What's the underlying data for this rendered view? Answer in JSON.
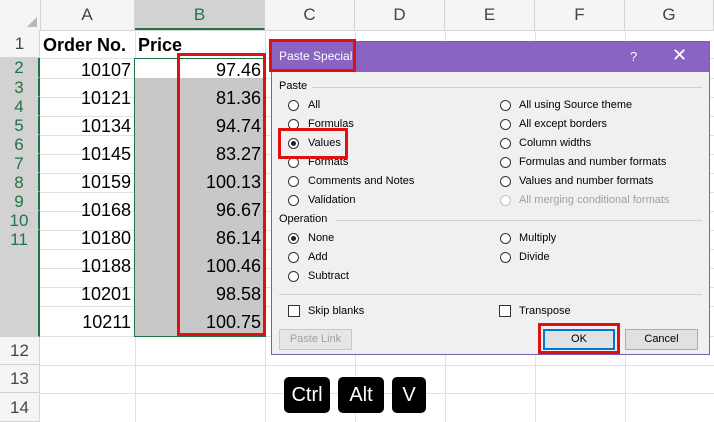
{
  "columns": [
    "A",
    "B",
    "C",
    "D",
    "E",
    "F",
    "G"
  ],
  "rows": [
    "1",
    "2",
    "3",
    "4",
    "5",
    "6",
    "7",
    "8",
    "9",
    "10",
    "11",
    "12",
    "13",
    "14"
  ],
  "headers": {
    "order": "Order No.",
    "price": "Price"
  },
  "order_numbers": [
    "10107",
    "10121",
    "10134",
    "10145",
    "10159",
    "10168",
    "10180",
    "10188",
    "10201",
    "10211"
  ],
  "prices": [
    "97.46",
    "81.36",
    "94.74",
    "83.27",
    "100.13",
    "96.67",
    "86.14",
    "100.46",
    "98.58",
    "100.75"
  ],
  "dialog": {
    "title": "Paste Special",
    "help": "?",
    "close": "✕",
    "paste_label": "Paste",
    "paste_left": [
      "All",
      "Formulas",
      "Values",
      "Formats",
      "Comments and Notes",
      "Validation"
    ],
    "paste_right": [
      "All using Source theme",
      "All except borders",
      "Column widths",
      "Formulas and number formats",
      "Values and number formats",
      "All merging conditional formats"
    ],
    "selected_paste": "Values",
    "operation_label": "Operation",
    "op_left": [
      "None",
      "Add",
      "Subtract"
    ],
    "op_right": [
      "Multiply",
      "Divide"
    ],
    "selected_operation": "None",
    "skip_blanks": "Skip blanks",
    "transpose": "Transpose",
    "paste_link": "Paste Link",
    "ok": "OK",
    "cancel": "Cancel"
  },
  "keys": [
    "Ctrl",
    "Alt",
    "V"
  ],
  "colors": {
    "accent": "#8a63c3",
    "highlight": "#e01010",
    "excel_green": "#217346"
  }
}
